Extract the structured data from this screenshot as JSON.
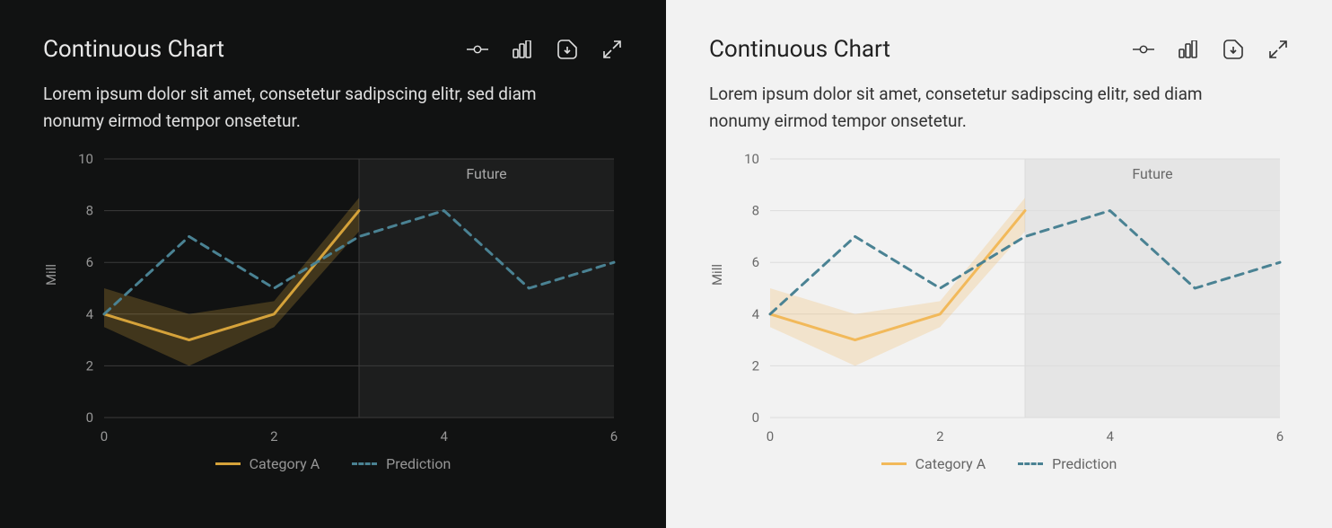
{
  "title": "Continuous Chart",
  "subtitle": "Lorem ipsum dolor sit amet, consetetur sadipscing elitr, sed diam nonumy eirmod tempor onsetetur.",
  "ylabel": "Mill",
  "future_label": "Future",
  "legend": {
    "categoryA": "Category A",
    "prediction": "Prediction"
  },
  "colors": {
    "categoryA_dark": "#d5a23a",
    "categoryA_light": "#f2b95a",
    "prediction": "#4a8293"
  },
  "toolbar_icons": [
    "line-chart-icon",
    "bar-chart-icon",
    "download-icon",
    "expand-icon"
  ],
  "chart_data": {
    "type": "line",
    "xlabel": "",
    "ylabel": "Mill",
    "x_ticks": [
      0,
      2,
      4,
      6
    ],
    "y_ticks": [
      0,
      2,
      4,
      6,
      8,
      10
    ],
    "xlim": [
      0,
      6
    ],
    "ylim": [
      0,
      10
    ],
    "future_region": {
      "from": 3,
      "to": 6,
      "label": "Future"
    },
    "x": [
      0,
      1,
      2,
      3,
      4,
      5,
      6
    ],
    "series": [
      {
        "name": "Category A",
        "style": "solid",
        "color": "#f2b95a",
        "values": [
          4,
          3,
          4,
          8,
          null,
          null,
          null
        ],
        "band_lower": [
          3.5,
          2,
          3.5,
          7.2
        ],
        "band_upper": [
          5,
          4,
          4.5,
          8.5
        ]
      },
      {
        "name": "Prediction",
        "style": "dashed",
        "color": "#4a8293",
        "values": [
          4,
          7,
          5,
          7,
          8,
          5,
          6
        ]
      }
    ]
  }
}
